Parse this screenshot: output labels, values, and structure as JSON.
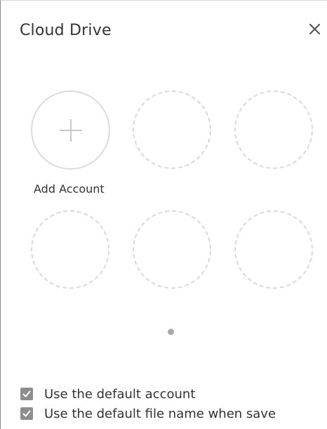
{
  "dialog": {
    "title": "Cloud Drive",
    "close_icon": "close-icon"
  },
  "accounts": {
    "add_label": "Add Account",
    "add_icon": "plus-icon",
    "empty_slots": 5,
    "pages": 1,
    "current_page": 1
  },
  "options": [
    {
      "label": "Use the default account",
      "checked": true
    },
    {
      "label": "Use the default file name when save",
      "checked": true
    }
  ],
  "colors": {
    "text": "#333333",
    "checkbox": "#8e8e8e",
    "slot_border": "#d9d9d9",
    "page_dot": "#a9a9a9"
  }
}
